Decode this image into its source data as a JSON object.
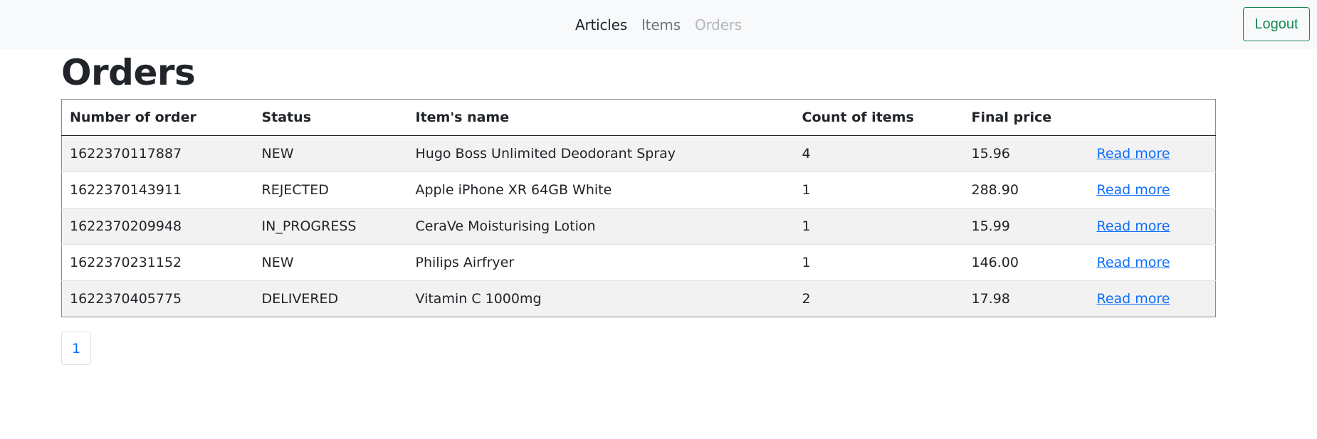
{
  "nav": {
    "links": [
      {
        "label": "Articles",
        "color": "#212529"
      },
      {
        "label": "Items",
        "color": "#6c757d"
      },
      {
        "label": "Orders",
        "color": "#b4b6b8"
      }
    ],
    "logout_label": "Logout"
  },
  "page": {
    "title": "Orders"
  },
  "table": {
    "headers": [
      "Number of order",
      "Status",
      "Item's name",
      "Count of items",
      "Final price",
      ""
    ],
    "rows": [
      {
        "number": "1622370117887",
        "status": "NEW",
        "item": "Hugo Boss Unlimited Deodorant Spray",
        "count": "4",
        "price": "15.96",
        "link": "Read more"
      },
      {
        "number": "1622370143911",
        "status": "REJECTED",
        "item": "Apple iPhone XR 64GB White",
        "count": "1",
        "price": "288.90",
        "link": "Read more"
      },
      {
        "number": "1622370209948",
        "status": "IN_PROGRESS",
        "item": "CeraVe Moisturising Lotion",
        "count": "1",
        "price": "15.99",
        "link": "Read more"
      },
      {
        "number": "1622370231152",
        "status": "NEW",
        "item": "Philips Airfryer",
        "count": "1",
        "price": "146.00",
        "link": "Read more"
      },
      {
        "number": "1622370405775",
        "status": "DELIVERED",
        "item": "Vitamin C 1000mg",
        "count": "2",
        "price": "17.98",
        "link": "Read more"
      }
    ]
  },
  "pagination": {
    "current": "1"
  },
  "colors": {
    "accent_link": "#0d6efd",
    "logout": "#198754",
    "navbar_bg": "#f8f9fa",
    "stripe": "#f2f2f2"
  }
}
